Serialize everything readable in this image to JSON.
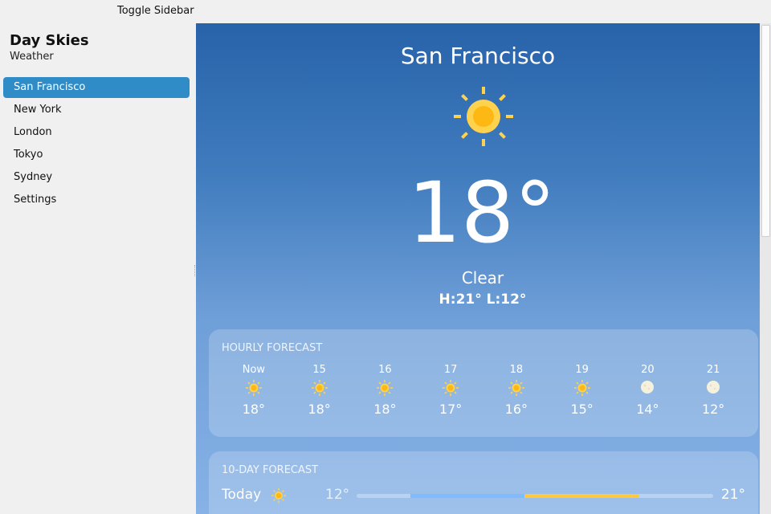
{
  "topbar": {
    "toggle_label": "Toggle Sidebar"
  },
  "sidebar": {
    "title": "Day Skies",
    "subtitle": "Weather",
    "items": [
      {
        "label": "San Francisco",
        "active": true
      },
      {
        "label": "New York",
        "active": false
      },
      {
        "label": "London",
        "active": false
      },
      {
        "label": "Tokyo",
        "active": false
      },
      {
        "label": "Sydney",
        "active": false
      },
      {
        "label": "Settings",
        "active": false
      }
    ]
  },
  "current": {
    "city": "San Francisco",
    "icon": "sun-icon",
    "temp": "18°",
    "condition": "Clear",
    "hilo": "H:21° L:12°"
  },
  "hourly": {
    "label": "HOURLY FORECAST",
    "hours": [
      {
        "time": "Now",
        "icon": "sun",
        "temp": "18°"
      },
      {
        "time": "15",
        "icon": "sun",
        "temp": "18°"
      },
      {
        "time": "16",
        "icon": "sun",
        "temp": "18°"
      },
      {
        "time": "17",
        "icon": "sun",
        "temp": "17°"
      },
      {
        "time": "18",
        "icon": "sun",
        "temp": "16°"
      },
      {
        "time": "19",
        "icon": "sun",
        "temp": "15°"
      },
      {
        "time": "20",
        "icon": "moon",
        "temp": "14°"
      },
      {
        "time": "21",
        "icon": "moon",
        "temp": "12°"
      }
    ]
  },
  "daily": {
    "label": "10-DAY FORECAST",
    "days": [
      {
        "name": "Today",
        "icon": "sun",
        "low": "12°",
        "high": "21°",
        "range_start": 0.15,
        "range_warm": 0.47,
        "range_end": 0.79
      }
    ]
  },
  "colors": {
    "accent": "#308cc6",
    "sun": "#fdb813",
    "sun_ray": "#ffd24d",
    "bar_cool": "#7fbcff",
    "bar_warm": "#ffc83d",
    "moon": "#f5f1dc"
  }
}
